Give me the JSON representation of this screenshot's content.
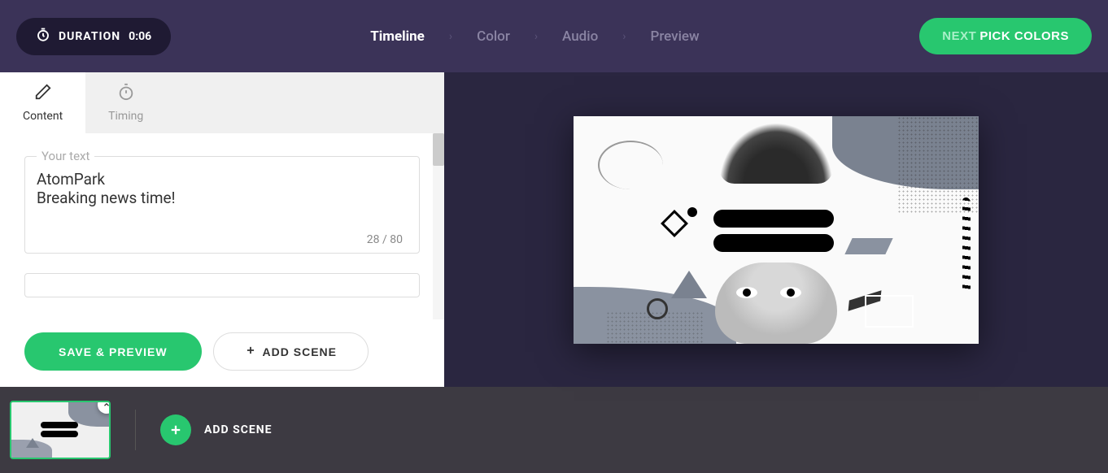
{
  "header": {
    "duration_label": "DURATION",
    "duration_time": "0:06",
    "steps": [
      "Timeline",
      "Color",
      "Audio",
      "Preview"
    ],
    "active_step": 0,
    "next_prefix": "NEXT",
    "next_action": "PICK COLORS"
  },
  "tabs": {
    "items": [
      {
        "label": "Content",
        "icon": "pencil"
      },
      {
        "label": "Timing",
        "icon": "stopwatch"
      }
    ],
    "active": 0
  },
  "editor": {
    "field_label": "Your text",
    "text_value": "AtomPark\nBreaking news time!",
    "char_count": "28",
    "char_max": "80"
  },
  "actions": {
    "save_preview": "SAVE & PREVIEW",
    "add_scene": "ADD SCENE"
  },
  "bottom": {
    "add_scene": "ADD SCENE"
  },
  "colors": {
    "accent": "#28c76f",
    "header_bg": "#3b3358",
    "canvas_bg": "#2a2640"
  }
}
